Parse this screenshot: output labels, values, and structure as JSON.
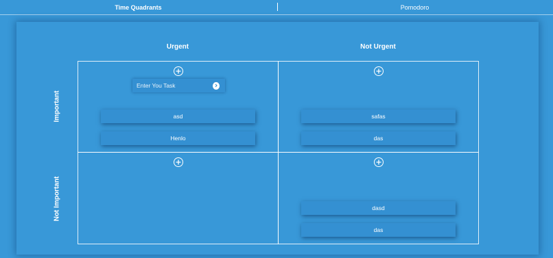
{
  "nav": {
    "tabs": [
      {
        "label": "Time Quadrants",
        "active": true
      },
      {
        "label": "Pomodoro",
        "active": false
      }
    ]
  },
  "board": {
    "columns": [
      "Urgent",
      "Not Urgent"
    ],
    "rows": [
      "Important",
      "Not Important"
    ],
    "input": {
      "placeholder": "Enter You Task",
      "value": ""
    },
    "quadrants": {
      "urgent_important": {
        "tasks": [
          "asd",
          "Henlo"
        ]
      },
      "not_urgent_important": {
        "tasks": [
          "safas",
          "das"
        ]
      },
      "urgent_not_important": {
        "tasks": []
      },
      "not_urgent_not_important": {
        "tasks": [
          "dasd",
          "das"
        ]
      }
    }
  },
  "icons": {
    "add": "plus-circle-icon",
    "submit": "chevron-right-icon"
  },
  "colors": {
    "background": "#3898d8",
    "task_card": "#3490d2",
    "text": "#ffffff"
  }
}
